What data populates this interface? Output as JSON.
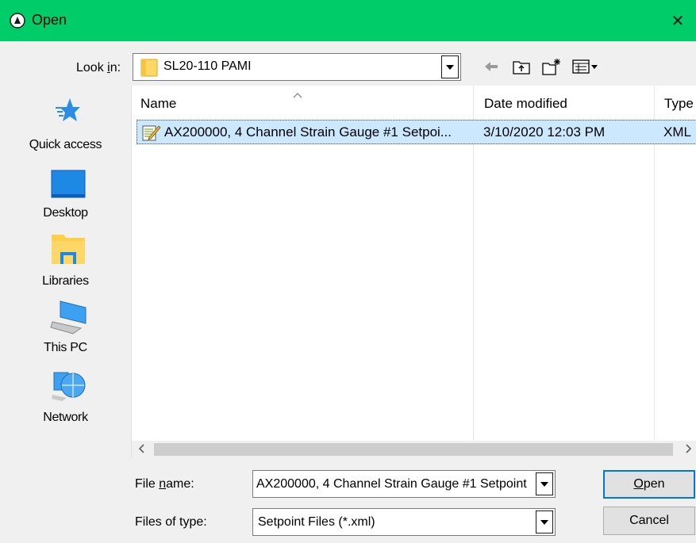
{
  "window": {
    "title": "Open",
    "close_glyph": "✕"
  },
  "lookin": {
    "label_pre": "Look ",
    "label_accel": "i",
    "label_post": "n:",
    "value": "SL20-110 PAMI"
  },
  "places": [
    {
      "label": "Quick access",
      "icon": "star-icon"
    },
    {
      "label": "Desktop",
      "icon": "desktop-icon"
    },
    {
      "label": "Libraries",
      "icon": "libraries-icon"
    },
    {
      "label": "This PC",
      "icon": "computer-icon"
    },
    {
      "label": "Network",
      "icon": "network-icon"
    }
  ],
  "filelist": {
    "columns": [
      "Name",
      "Date modified",
      "Type"
    ],
    "rows": [
      {
        "name": "AX200000, 4 Channel Strain Gauge #1 Setpoi...",
        "date": "3/10/2020 12:03 PM",
        "type": "XML"
      }
    ]
  },
  "filename": {
    "label_pre": "File ",
    "label_accel": "n",
    "label_post": "ame:",
    "value": "AX200000, 4 Channel Strain Gauge #1 Setpoint"
  },
  "filetype": {
    "label": "Files of type:",
    "value": "Setpoint Files (*.xml)"
  },
  "buttons": {
    "open_accel": "O",
    "open_rest": "pen",
    "cancel": "Cancel"
  },
  "colors": {
    "titlebar": "#00cc6a",
    "selection": "#cce8ff"
  }
}
